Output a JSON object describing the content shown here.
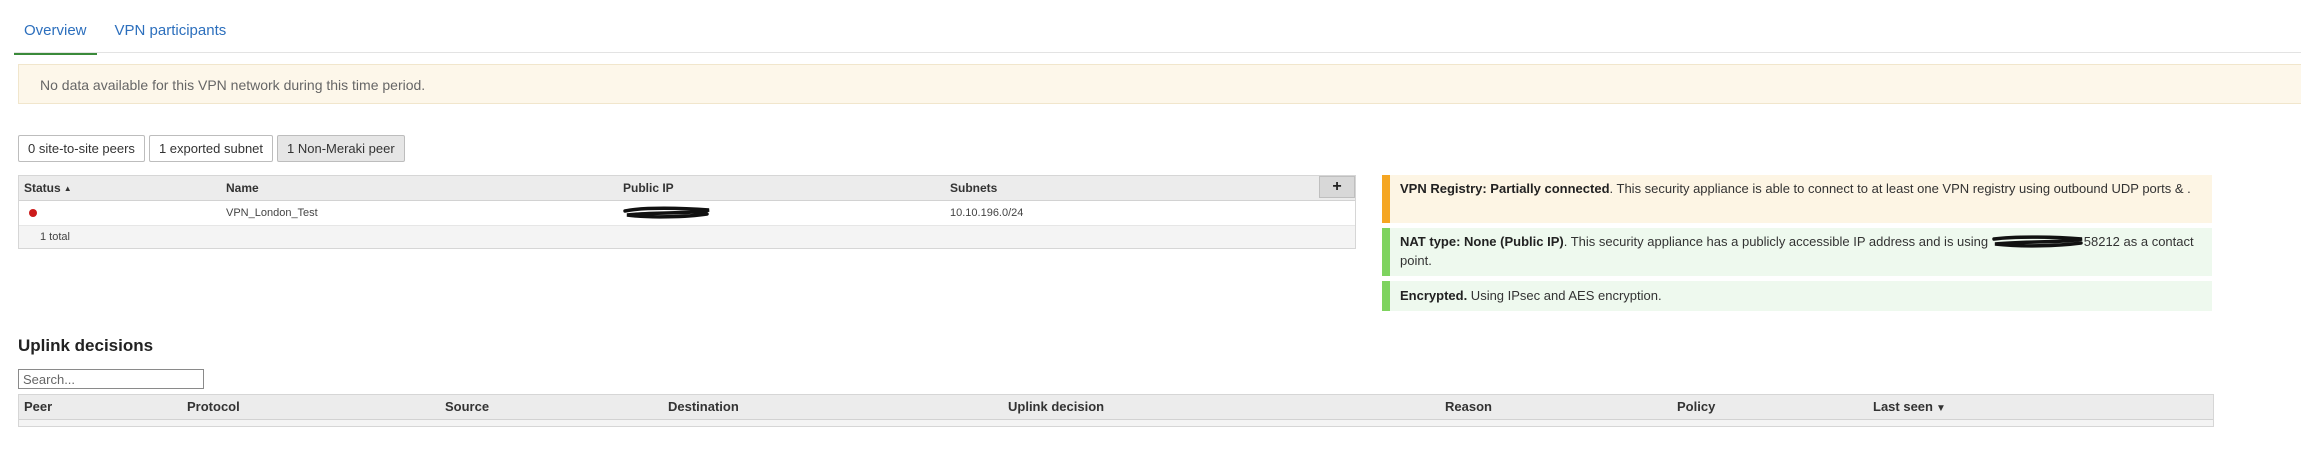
{
  "tabs": [
    {
      "label": "Overview",
      "active": true
    },
    {
      "label": "VPN participants",
      "active": false
    }
  ],
  "banner": {
    "message": "No data available for this VPN network during this time period."
  },
  "filters": [
    {
      "label": "0 site-to-site peers",
      "active": false
    },
    {
      "label": "1 exported subnet",
      "active": false
    },
    {
      "label": "1 Non-Meraki peer",
      "active": true
    }
  ],
  "peers_table": {
    "columns": [
      "Status",
      "Name",
      "Public IP",
      "Subnets"
    ],
    "sort_indicator": "▲",
    "add_label": "+",
    "rows": [
      {
        "status": "offline",
        "status_color": "#cc1a1a",
        "name": "VPN_London_Test",
        "public_ip": "",
        "subnets": "10.10.196.0/24"
      }
    ],
    "footer": "1 total"
  },
  "status_boxes": [
    {
      "title": "VPN Registry: Partially connected",
      "text": ". This security appliance is able to connect to at least one VPN registry using outbound UDP ports & .",
      "color": "#f5a623"
    },
    {
      "title": "NAT type: None (Public IP)",
      "text_before": ". This security appliance has a publicly accessible IP address and is using ",
      "text_after": "58212 as a contact point.",
      "color": "#7ed35f"
    },
    {
      "title": "Encrypted.",
      "text": " Using IPsec and AES encryption.",
      "color": "#7ed35f"
    }
  ],
  "uplink": {
    "title": "Uplink decisions",
    "search_placeholder": "Search...",
    "columns": [
      "Peer",
      "Protocol",
      "Source",
      "Destination",
      "Uplink decision",
      "Reason",
      "Policy",
      "Last seen"
    ],
    "sort_indicator": "▼"
  }
}
